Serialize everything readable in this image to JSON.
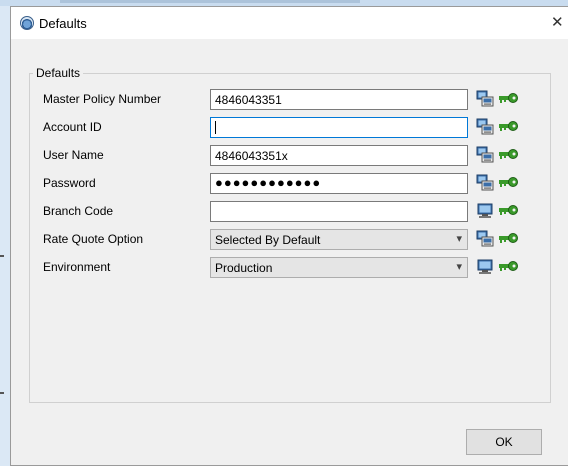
{
  "window": {
    "title": "Defaults",
    "close_label": "✕"
  },
  "group": {
    "legend": "Defaults"
  },
  "fields": [
    {
      "label": "Master Policy Number",
      "value": "4846043351",
      "kind": "text"
    },
    {
      "label": "Account ID",
      "value": "",
      "kind": "text",
      "focused": true
    },
    {
      "label": "User Name",
      "value": "4846043351x",
      "kind": "text"
    },
    {
      "label": "Password",
      "value": "●●●●●●●●●●●●",
      "kind": "password"
    },
    {
      "label": "Branch Code",
      "value": "",
      "kind": "text"
    },
    {
      "label": "Rate Quote Option",
      "value": "Selected By Default",
      "kind": "select"
    },
    {
      "label": "Environment",
      "value": "Production",
      "kind": "select"
    }
  ],
  "icons": {
    "row_left": "computer-icon",
    "row_right": "key-icon",
    "chevron": "▾"
  },
  "colors": {
    "key_green": "#3a9a2a",
    "focus_border": "#0078d7"
  },
  "buttons": {
    "ok_label": "OK"
  }
}
